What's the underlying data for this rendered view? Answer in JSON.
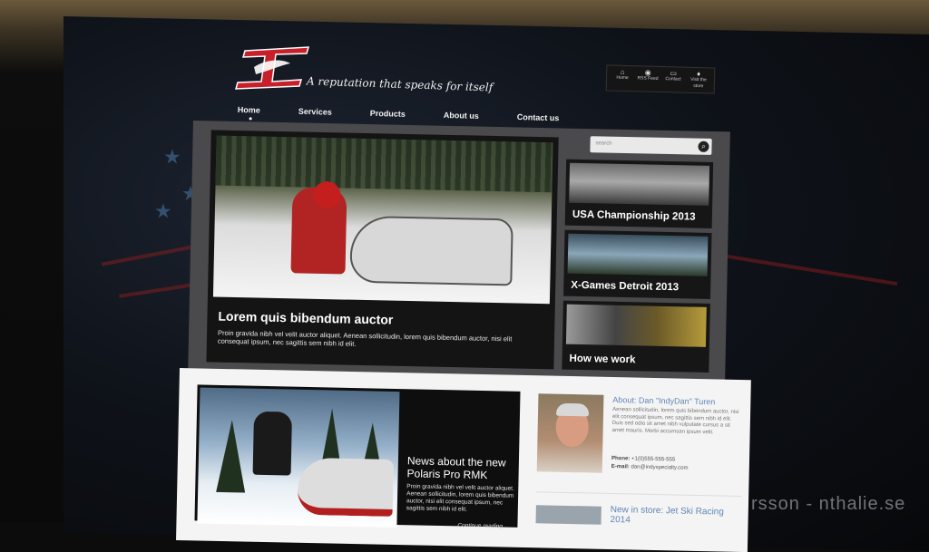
{
  "brand": {
    "tagline": "A reputation that speaks for itself",
    "accent": "#d0202a"
  },
  "utility_nav": [
    {
      "label": "Home",
      "icon": "home-icon"
    },
    {
      "label": "RSS Feed",
      "icon": "rss-icon"
    },
    {
      "label": "Contact",
      "icon": "chat-icon"
    },
    {
      "label": "Visit the store",
      "icon": "location-pin-icon"
    }
  ],
  "nav": {
    "items": [
      "Home",
      "Services",
      "Products",
      "About us",
      "Contact us"
    ],
    "active": "Home"
  },
  "search": {
    "placeholder": "search"
  },
  "hero": {
    "title": "Lorem quis bibendum auctor",
    "text": "Proin gravida nibh vel velit auctor aliquet. Aenean sollicitudin, lorem quis bibendum auctor, nisi elit consequat ipsum, nec sagittis sem nibh id elit."
  },
  "tiles": [
    "USA Championship 2013",
    "X-Games Detroit 2013",
    "How we work"
  ],
  "news": {
    "title": "News about the new Polaris Pro RMK",
    "text": "Proin gravida nibh vel velit auctor aliquet. Aenean sollicitudin, lorem quis bibendum auctor, nisi elit consequat ipsum, nec sagittis sem nibh id elit.",
    "more": "Continue reading..."
  },
  "about": {
    "title": "About: Dan \"IndyDan\" Turen",
    "text": "Aenean sollicitudin, lorem quis bibendum auctor, nisi elit consequat ipsum, nec sagittis sem nibh id elit. Duis sed odio sit amet nibh vulputate cursus a sit amet mauris. Morbi accumsan ipsum velit.",
    "phone_label": "Phone:",
    "phone": "+1(0)555-555-555",
    "email_label": "E-mail:",
    "email": "dan@indyspecialty.com"
  },
  "in_store": {
    "title": "New in store: Jet Ski Racing 2014"
  },
  "watermark": "rsson - nthalie.se"
}
